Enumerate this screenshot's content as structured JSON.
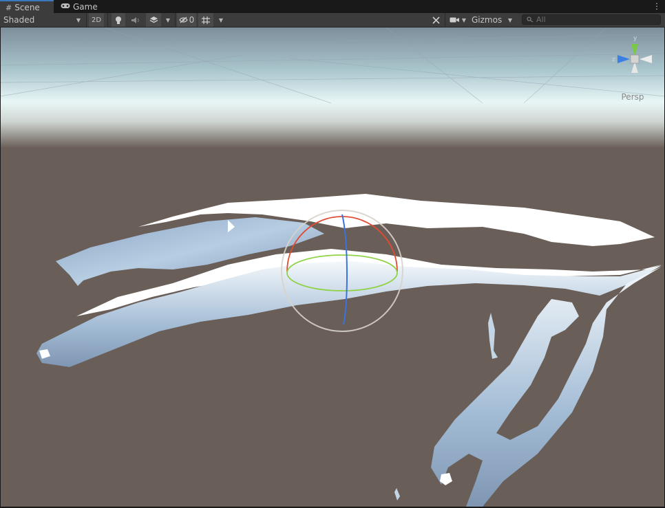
{
  "tabs": [
    {
      "label": "Scene",
      "icon": "grid-icon",
      "active": true
    },
    {
      "label": "Game",
      "icon": "gamepad-icon",
      "active": false
    }
  ],
  "toolbar": {
    "shading_mode": "Shaded",
    "mode_2d_label": "2D",
    "hidden_count": "0",
    "gizmos_label": "Gizmos",
    "search_placeholder": "All"
  },
  "viewport": {
    "projection_label": "Persp",
    "gizmo_axes": {
      "y": "y",
      "z": "z"
    }
  },
  "colors": {
    "accent": "#3a79bb",
    "ground": "#6a5f58",
    "sky_top": "#7d8e9b",
    "horizon": "#e8f6f6",
    "mesh_light": "#a9c3dc",
    "axis_x": "#e04b34",
    "axis_y": "#8bd13c",
    "axis_z": "#3a73e0"
  }
}
